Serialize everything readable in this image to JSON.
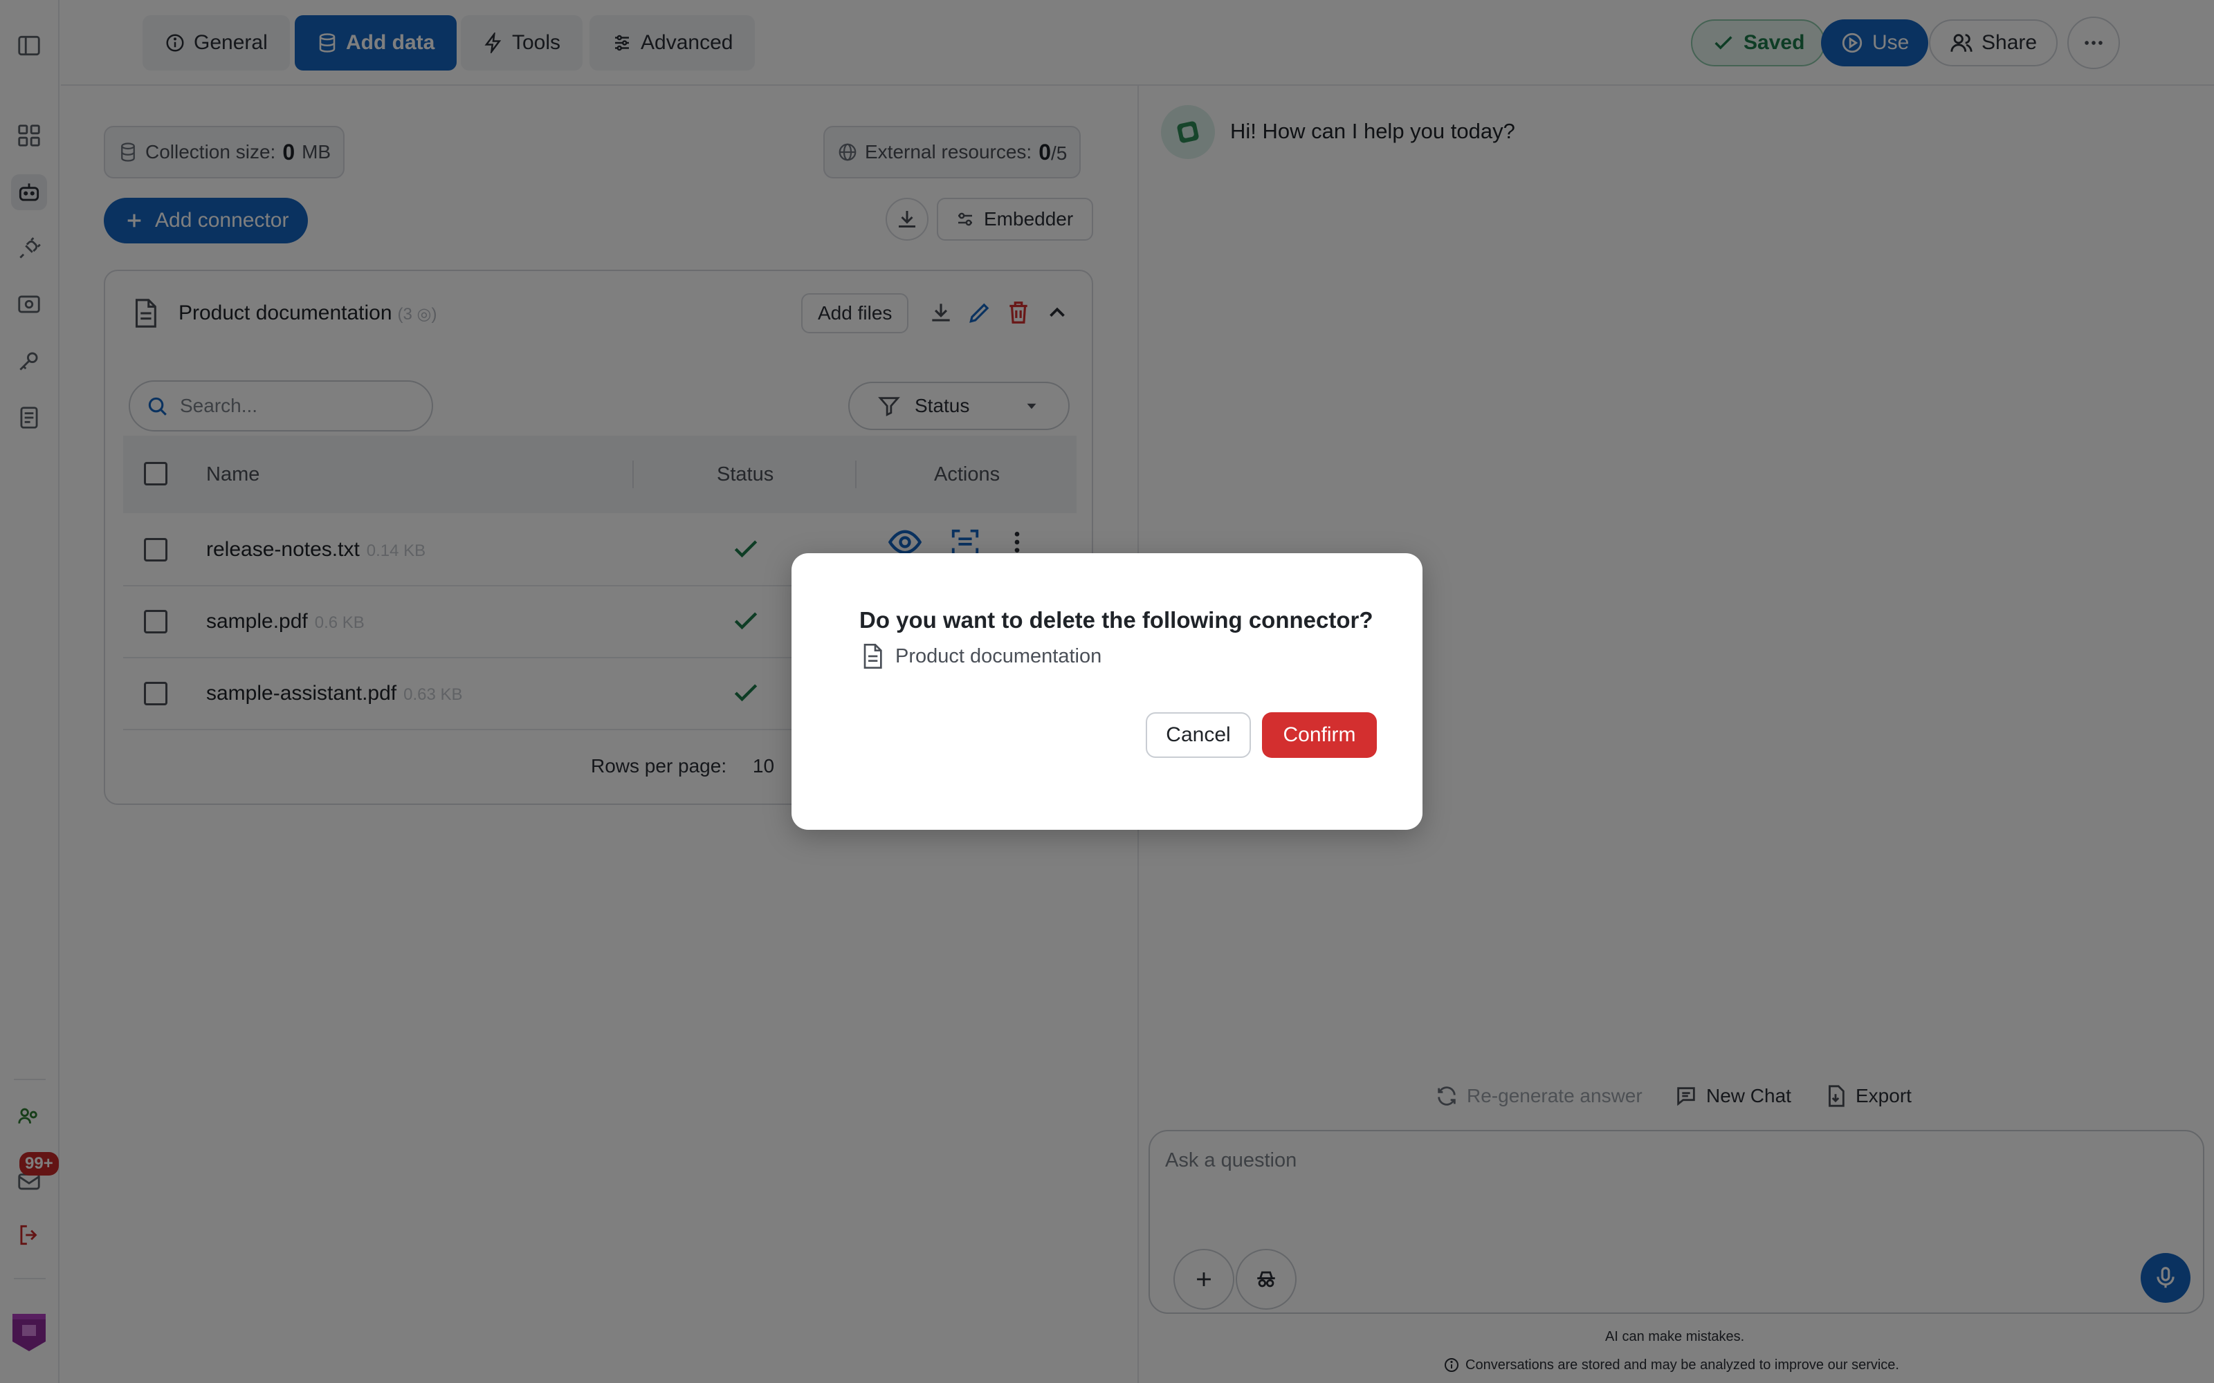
{
  "colors": {
    "accent": "#1565c0",
    "success": "#1d7a4b",
    "danger": "#d32f2f",
    "badge": "#c62828"
  },
  "rail": {
    "items": [
      {
        "name": "sidebar-toggle-icon"
      },
      {
        "name": "dashboard-grid-icon"
      },
      {
        "name": "assistant-bot-icon"
      },
      {
        "name": "plug-icon"
      },
      {
        "name": "settings-icon"
      },
      {
        "name": "key-icon"
      },
      {
        "name": "document-icon"
      }
    ],
    "notifications_badge": "99+",
    "bottom_items": [
      {
        "name": "team-icon"
      },
      {
        "name": "mail-icon"
      },
      {
        "name": "logout-icon"
      },
      {
        "name": "app-logo"
      }
    ]
  },
  "topbar": {
    "tabs": [
      {
        "label": "General",
        "icon": "info-icon"
      },
      {
        "label": "Add data",
        "icon": "database-icon",
        "active": true
      },
      {
        "label": "Tools",
        "icon": "lightning-icon"
      },
      {
        "label": "Advanced",
        "icon": "sliders-icon"
      }
    ],
    "saved_label": "Saved",
    "use_label": "Use",
    "share_label": "Share",
    "more_icon": "more-horizontal-icon"
  },
  "data_panel": {
    "collection_size_label": "Collection size:",
    "collection_size_value": "0",
    "collection_size_unit": "MB",
    "external_resources_label": "External resources:",
    "external_resources_value": "0",
    "external_resources_max": "/5",
    "add_connector_label": "Add connector",
    "embedder_label": "Embedder",
    "connector": {
      "title": "Product documentation",
      "count": "(3 ◎)",
      "add_files_label": "Add files",
      "search_placeholder": "Search...",
      "status_filter_label": "Status",
      "columns": {
        "name": "Name",
        "status": "Status",
        "actions": "Actions"
      },
      "files": [
        {
          "name": "release-notes.txt",
          "size": "0.14 KB",
          "status": "done"
        },
        {
          "name": "sample.pdf",
          "size": "0.6 KB",
          "status": "done"
        },
        {
          "name": "sample-assistant.pdf",
          "size": "0.63 KB",
          "status": "done"
        }
      ],
      "rows_per_page_label": "Rows per page:",
      "rows_per_page_value": "10"
    }
  },
  "chat": {
    "greeting": "Hi! How can I help you today?",
    "regenerate_label": "Re-generate answer",
    "new_chat_label": "New Chat",
    "export_label": "Export",
    "input_placeholder": "Ask a question",
    "disclaimer_1": "AI can make mistakes.",
    "disclaimer_2": "Conversations are stored and may be analyzed to improve our service."
  },
  "modal": {
    "title": "Do you want to delete the following connector?",
    "item_label": "Product documentation",
    "cancel_label": "Cancel",
    "confirm_label": "Confirm"
  }
}
